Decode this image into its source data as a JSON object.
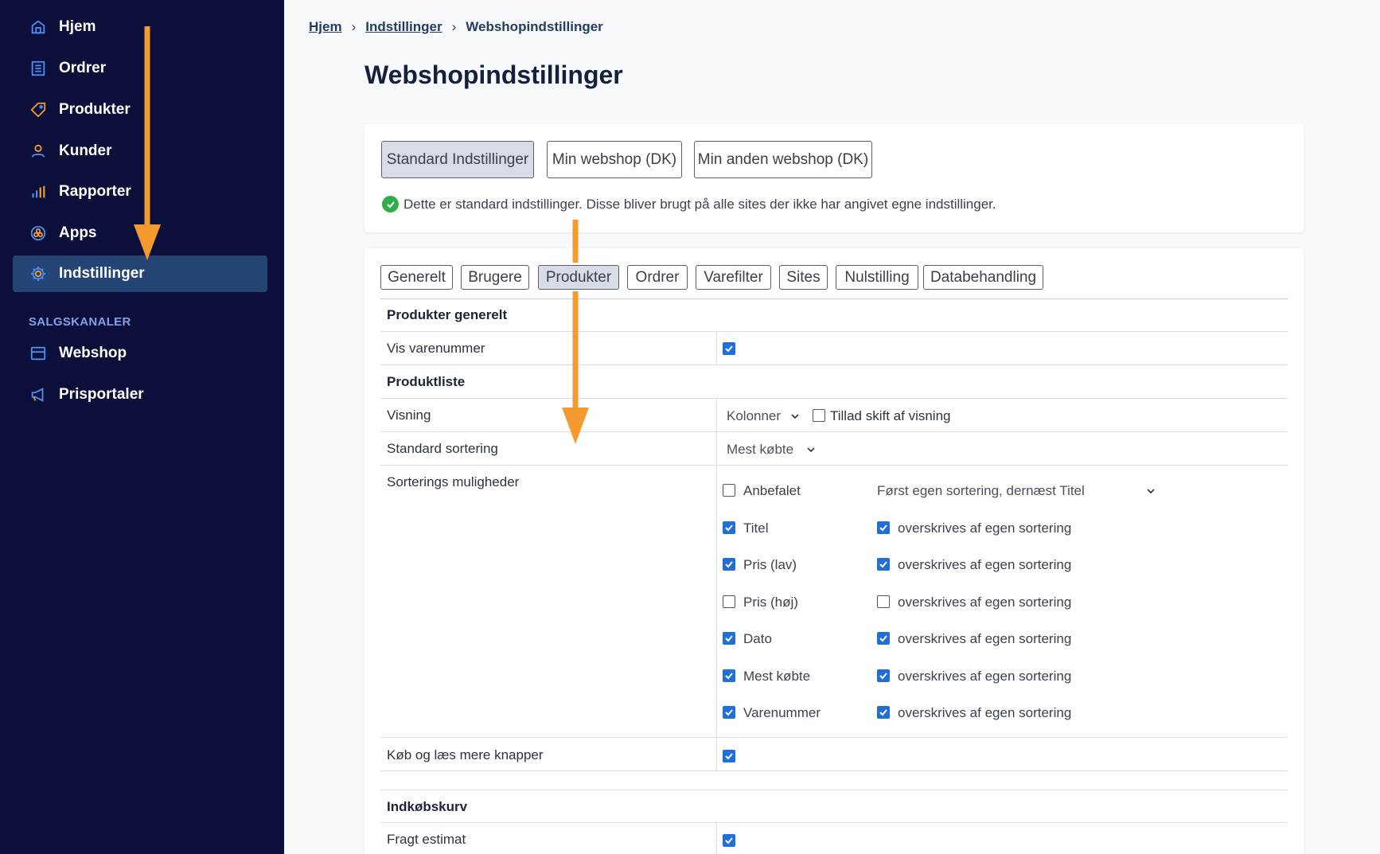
{
  "sidebar": {
    "items": [
      {
        "label": "Hjem",
        "icon": "home-icon"
      },
      {
        "label": "Ordrer",
        "icon": "orders-icon"
      },
      {
        "label": "Produkter",
        "icon": "tag-icon"
      },
      {
        "label": "Kunder",
        "icon": "user-icon"
      },
      {
        "label": "Rapporter",
        "icon": "bar-chart-icon"
      },
      {
        "label": "Apps",
        "icon": "apps-icon"
      },
      {
        "label": "Indstillinger",
        "icon": "gear-icon",
        "active": true
      }
    ],
    "section_label": "SALGSKANALER",
    "channels": [
      {
        "label": "Webshop",
        "icon": "store-icon"
      },
      {
        "label": "Prisportaler",
        "icon": "megaphone-icon"
      }
    ]
  },
  "breadcrumb": {
    "home": "Hjem",
    "settings": "Indstillinger",
    "current": "Webshopindstillinger"
  },
  "page": {
    "title": "Webshopindstillinger"
  },
  "sites": {
    "buttons": [
      "Standard Indstillinger",
      "Min webshop (DK)",
      "Min anden webshop (DK)"
    ],
    "active_index": 0,
    "info_text": "Dette er standard indstillinger. Disse bliver brugt på alle sites der ikke har angivet egne indstillinger."
  },
  "tabs": {
    "items": [
      "Generelt",
      "Brugere",
      "Produkter",
      "Ordrer",
      "Varefilter",
      "Sites",
      "Nulstilling",
      "Databehandling"
    ],
    "active_index": 2
  },
  "settings": {
    "section_general": "Produkter generelt",
    "show_sku_label": "Vis varenummer",
    "show_sku_checked": true,
    "section_list": "Produktliste",
    "view_label": "Visning",
    "view_value": "Kolonner",
    "allow_switch_label": "Tillad skift af visning",
    "allow_switch_checked": false,
    "default_sort_label": "Standard sortering",
    "default_sort_value": "Mest købte",
    "sort_options_label": "Sorterings muligheder",
    "sort_options": [
      {
        "label": "Anbefalet",
        "checked": false,
        "secondary": "Først egen sortering, dernæst Titel",
        "secondary_type": "select"
      },
      {
        "label": "Titel",
        "checked": true,
        "secondary": "overskrives af egen sortering",
        "secondary_checked": true
      },
      {
        "label": "Pris (lav)",
        "checked": true,
        "secondary": "overskrives af egen sortering",
        "secondary_checked": true
      },
      {
        "label": "Pris (høj)",
        "checked": false,
        "secondary": "overskrives af egen sortering",
        "secondary_checked": false
      },
      {
        "label": "Dato",
        "checked": true,
        "secondary": "overskrives af egen sortering",
        "secondary_checked": true
      },
      {
        "label": "Mest købte",
        "checked": true,
        "secondary": "overskrives af egen sortering",
        "secondary_checked": true
      },
      {
        "label": "Varenummer",
        "checked": true,
        "secondary": "overskrives af egen sortering",
        "secondary_checked": true
      }
    ],
    "buy_buttons_label": "Køb og læs mere knapper",
    "buy_buttons_checked": true,
    "section_cart": "Indkøbskurv",
    "shipping_label": "Fragt estimat",
    "shipping_checked": true
  },
  "colors": {
    "sidebar_bg": "#0b0f3a",
    "active_item_bg": "#234474",
    "accent_blue": "#1f6fd6",
    "annotation_orange": "#f59a2f",
    "success_green": "#2fae4b"
  }
}
